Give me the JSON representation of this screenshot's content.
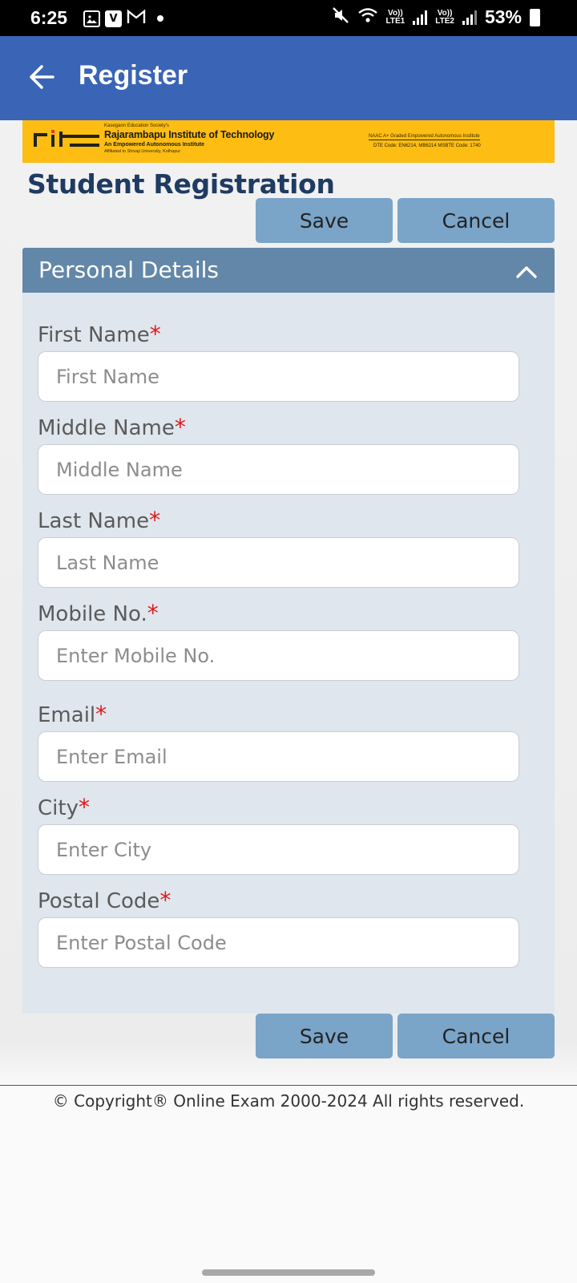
{
  "status_bar": {
    "time": "6:25",
    "battery": "53%",
    "net1": "Vo))\nLTE1",
    "net2": "Vo))\nLTE2",
    "icons": [
      "gallery-icon",
      "v-app-icon",
      "gmail-icon",
      "dot-icon",
      "mute-icon",
      "wifi-icon",
      "signal-icon",
      "battery-icon"
    ]
  },
  "appbar": {
    "title": "Register",
    "back_icon": "arrow-left-icon"
  },
  "banner": {
    "society": "Kasegaon Education Society's",
    "name": "Rajarambapu Institute of Technology",
    "sub": "An Empowered Autonomous Institute",
    "affiliation": "Affiliated to Shivaji University, Kolhapur",
    "naac": "NAAC A+ Graded Empowered Autonomous Institute",
    "codes": "DTE Code: EN6214, MB6214  MSBTE Code: 1740",
    "logo_text": "rit",
    "logo_caption": "RAJARAMBAPU INSTITUTE OF TECHNOLOGY",
    "accent_color": "#fdbd12"
  },
  "page": {
    "heading": "Student Registration",
    "save_label": "Save",
    "cancel_label": "Cancel"
  },
  "panel": {
    "title": "Personal Details",
    "fields": [
      {
        "label": "First Name",
        "required": "*",
        "placeholder": "First Name"
      },
      {
        "label": "Middle Name",
        "required": "*",
        "placeholder": "Middle Name"
      },
      {
        "label": "Last Name",
        "required": "*",
        "placeholder": "Last Name"
      },
      {
        "label": "Mobile No.",
        "required": "*",
        "placeholder": "Enter Mobile No."
      },
      {
        "label": "Email",
        "required": "*",
        "placeholder": "Enter Email"
      },
      {
        "label": "City",
        "required": "*",
        "placeholder": "Enter City"
      },
      {
        "label": "Postal Code",
        "required": "*",
        "placeholder": "Enter Postal Code"
      }
    ]
  },
  "footer": {
    "text": "© Copyright® Online Exam 2000-2024 All rights reserved."
  },
  "colors": {
    "appbar": "#3a64b6",
    "button": "#7aa4c8",
    "panel_header": "#6287a8",
    "panel_body": "#dfe6ed",
    "heading": "#1f3b63",
    "required": "#e01818"
  }
}
